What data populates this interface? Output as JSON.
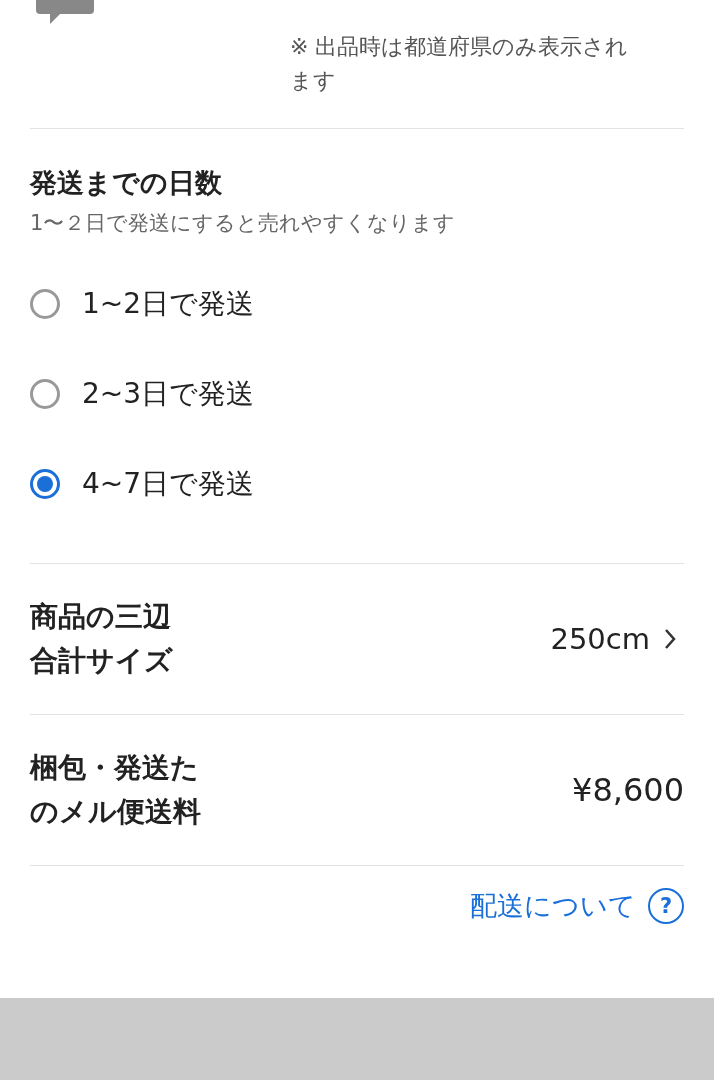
{
  "address_note": "※ 出品時は都道府県のみ表示されます",
  "shipping_days": {
    "title": "発送までの日数",
    "hint": "1〜２日で発送にすると売れやすくなります",
    "options": [
      {
        "label": "1~2日で発送",
        "selected": false
      },
      {
        "label": "2~3日で発送",
        "selected": false
      },
      {
        "label": "4~7日で発送",
        "selected": true
      }
    ]
  },
  "size": {
    "label": "商品の三辺合計サイズ",
    "value": "250cm"
  },
  "fee": {
    "label": "梱包・発送たのメル便送料",
    "value": "¥8,600"
  },
  "help_link": {
    "label": "配送について",
    "icon": "?"
  }
}
